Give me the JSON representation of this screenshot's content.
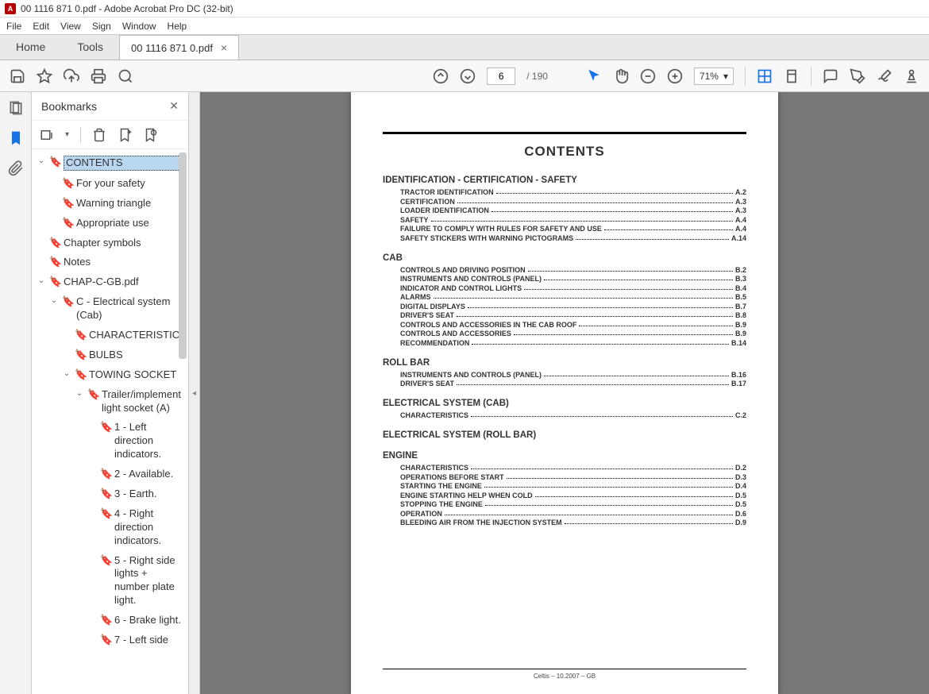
{
  "title": "00 1116 871 0.pdf - Adobe Acrobat Pro DC (32-bit)",
  "menu": [
    "File",
    "Edit",
    "View",
    "Sign",
    "Window",
    "Help"
  ],
  "tabs": {
    "home": "Home",
    "tools": "Tools",
    "doc": "00 1116 871 0.pdf"
  },
  "toolbar": {
    "page": "6",
    "total": "/ 190",
    "zoom": "71%"
  },
  "bookmarks_title": "Bookmarks",
  "tree": {
    "contents": "CONTENTS",
    "fys": "For your safety",
    "wt": "Warning triangle",
    "au": "Appropriate use",
    "cs": "Chapter symbols",
    "notes": "Notes",
    "chap": "CHAP-C-GB.pdf",
    "c_elec": "C - Electrical system (Cab)",
    "char": "CHARACTERISTICS",
    "bulbs": "BULBS",
    "towing": "TOWING SOCKET",
    "trailer": "Trailer/implement light socket (A)",
    "i1": "1 - Left direction indicators.",
    "i2": "2 - Available.",
    "i3": "3 - Earth.",
    "i4": "4 - Right direction indicators.",
    "i5": "5 - Right side lights + number plate light.",
    "i6": "6 - Brake light.",
    "i7": "7 - Left side"
  },
  "doc": {
    "title": "CONTENTS",
    "footer": "Celtis –   10.2007 – GB",
    "sections": [
      {
        "head": "IDENTIFICATION - CERTIFICATION - SAFETY",
        "items": [
          [
            "TRACTOR IDENTIFICATION",
            "A.2"
          ],
          [
            "CERTIFICATION",
            "A.3"
          ],
          [
            "LOADER IDENTIFICATION",
            "A.3"
          ],
          [
            "SAFETY",
            "A.4"
          ],
          [
            "FAILURE TO COMPLY WITH RULES FOR SAFETY AND USE",
            "A.4"
          ],
          [
            "SAFETY STICKERS WITH WARNING PICTOGRAMS",
            "A.14"
          ]
        ]
      },
      {
        "head": "CAB",
        "items": [
          [
            "CONTROLS AND DRIVING POSITION",
            "B.2"
          ],
          [
            "INSTRUMENTS AND CONTROLS (PANEL)",
            "B.3"
          ],
          [
            "INDICATOR AND CONTROL LIGHTS",
            "B.4"
          ],
          [
            "ALARMS",
            "B.5"
          ],
          [
            "DIGITAL DISPLAYS",
            "B.7"
          ],
          [
            "DRIVER'S SEAT",
            "B.8"
          ],
          [
            "CONTROLS AND ACCESSORIES IN THE CAB ROOF",
            "B.9"
          ],
          [
            "CONTROLS AND ACCESSORIES",
            "B.9"
          ],
          [
            "RECOMMENDATION",
            "B.14"
          ]
        ]
      },
      {
        "head": "ROLL BAR",
        "items": [
          [
            "INSTRUMENTS AND CONTROLS (PANEL)",
            "B.16"
          ],
          [
            "DRIVER'S SEAT",
            "B.17"
          ]
        ]
      },
      {
        "head": "ELECTRICAL SYSTEM (CAB)",
        "items": [
          [
            "CHARACTERISTICS",
            "C.2"
          ]
        ]
      },
      {
        "head": "ELECTRICAL SYSTEM (ROLL BAR)",
        "items": []
      },
      {
        "head": "ENGINE",
        "items": [
          [
            "CHARACTERISTICS",
            "D.2"
          ],
          [
            "OPERATIONS BEFORE START",
            "D.3"
          ],
          [
            "STARTING THE ENGINE",
            "D.4"
          ],
          [
            "ENGINE STARTING HELP WHEN COLD",
            "D.5"
          ],
          [
            "STOPPING THE ENGINE",
            "D.5"
          ],
          [
            "OPERATION",
            "D.6"
          ],
          [
            "BLEEDING AIR FROM THE INJECTION SYSTEM",
            "D.9"
          ]
        ]
      }
    ]
  }
}
